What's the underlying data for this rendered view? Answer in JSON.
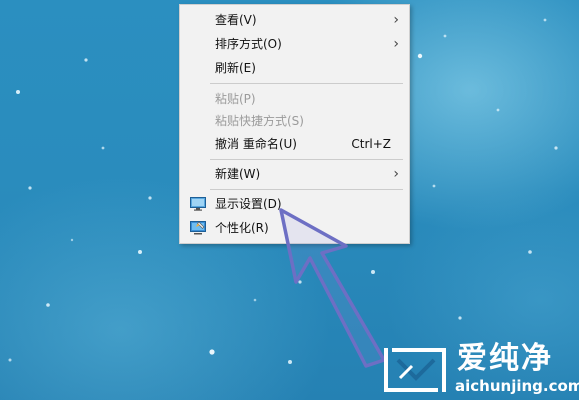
{
  "desktop": {
    "background_color": "#2a8cbd"
  },
  "context_menu": {
    "items": [
      {
        "label": "查看(V)",
        "has_submenu": true,
        "enabled": true
      },
      {
        "label": "排序方式(O)",
        "has_submenu": true,
        "enabled": true
      },
      {
        "label": "刷新(E)",
        "has_submenu": false,
        "enabled": true
      },
      {
        "label": "粘贴(P)",
        "has_submenu": false,
        "enabled": false
      },
      {
        "label": "粘贴快捷方式(S)",
        "has_submenu": false,
        "enabled": false
      },
      {
        "label": "撤消 重命名(U)",
        "shortcut": "Ctrl+Z",
        "has_submenu": false,
        "enabled": true
      },
      {
        "label": "新建(W)",
        "has_submenu": true,
        "enabled": true
      },
      {
        "label": "显示设置(D)",
        "icon": "display-settings-icon",
        "has_submenu": false,
        "enabled": true
      },
      {
        "label": "个性化(R)",
        "icon": "personalize-icon",
        "has_submenu": false,
        "enabled": true
      }
    ],
    "submenu_glyph": "›"
  },
  "annotation": {
    "arrow_color": "#6d6fc4",
    "points_to": "显示设置(D)"
  },
  "watermark": {
    "title": "爱纯净",
    "url": "aichunjing.com"
  }
}
